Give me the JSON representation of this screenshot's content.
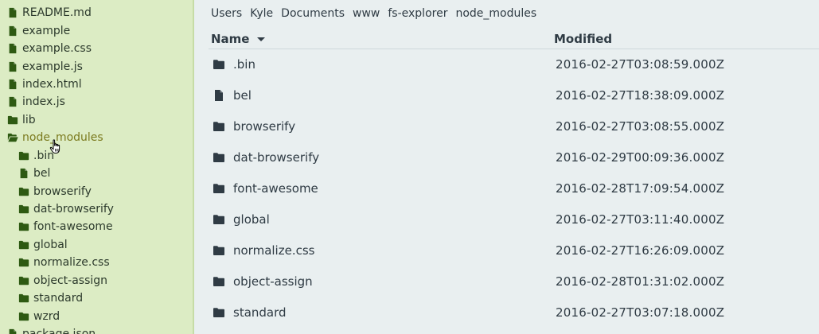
{
  "sidebar": {
    "items": [
      {
        "label": "README.md",
        "icon": "file-icon",
        "depth": 0
      },
      {
        "label": "example",
        "icon": "file-icon",
        "depth": 0
      },
      {
        "label": "example.css",
        "icon": "file-icon",
        "depth": 0
      },
      {
        "label": "example.js",
        "icon": "file-icon",
        "depth": 0
      },
      {
        "label": "index.html",
        "icon": "file-icon",
        "depth": 0
      },
      {
        "label": "index.js",
        "icon": "file-icon",
        "depth": 0
      },
      {
        "label": "lib",
        "icon": "folder-icon",
        "depth": 0
      },
      {
        "label": "node_modules",
        "icon": "folder-open-icon",
        "depth": 0,
        "open": true
      },
      {
        "label": ".bin",
        "icon": "folder-icon",
        "depth": 1
      },
      {
        "label": "bel",
        "icon": "file-icon",
        "depth": 1
      },
      {
        "label": "browserify",
        "icon": "folder-icon",
        "depth": 1
      },
      {
        "label": "dat-browserify",
        "icon": "folder-icon",
        "depth": 1
      },
      {
        "label": "font-awesome",
        "icon": "folder-icon",
        "depth": 1
      },
      {
        "label": "global",
        "icon": "folder-icon",
        "depth": 1
      },
      {
        "label": "normalize.css",
        "icon": "folder-icon",
        "depth": 1
      },
      {
        "label": "object-assign",
        "icon": "folder-icon",
        "depth": 1
      },
      {
        "label": "standard",
        "icon": "folder-icon",
        "depth": 1
      },
      {
        "label": "wzrd",
        "icon": "folder-icon",
        "depth": 1
      },
      {
        "label": "package.json",
        "icon": "file-icon",
        "depth": 0
      }
    ]
  },
  "breadcrumb": [
    "Users",
    "Kyle",
    "Documents",
    "www",
    "fs-explorer",
    "node_modules"
  ],
  "table": {
    "name_header": "Name",
    "modified_header": "Modified",
    "rows": [
      {
        "name": ".bin",
        "icon": "folder-icon",
        "modified": "2016-02-27T03:08:59.000Z"
      },
      {
        "name": "bel",
        "icon": "file-icon",
        "modified": "2016-02-27T18:38:09.000Z"
      },
      {
        "name": "browserify",
        "icon": "folder-icon",
        "modified": "2016-02-27T03:08:55.000Z"
      },
      {
        "name": "dat-browserify",
        "icon": "folder-icon",
        "modified": "2016-02-29T00:09:36.000Z"
      },
      {
        "name": "font-awesome",
        "icon": "folder-icon",
        "modified": "2016-02-28T17:09:54.000Z"
      },
      {
        "name": "global",
        "icon": "folder-icon",
        "modified": "2016-02-27T03:11:40.000Z"
      },
      {
        "name": "normalize.css",
        "icon": "folder-icon",
        "modified": "2016-02-27T16:26:09.000Z"
      },
      {
        "name": "object-assign",
        "icon": "folder-icon",
        "modified": "2016-02-28T01:31:02.000Z"
      },
      {
        "name": "standard",
        "icon": "folder-icon",
        "modified": "2016-02-27T03:07:18.000Z"
      }
    ]
  },
  "colors": {
    "sidebar_bg": "#dcecc4",
    "sidebar_icon": "#2e5a12",
    "open_folder_label": "#7b7a1e",
    "main_bg": "#e9eff0",
    "main_icon": "#2f3b44"
  }
}
